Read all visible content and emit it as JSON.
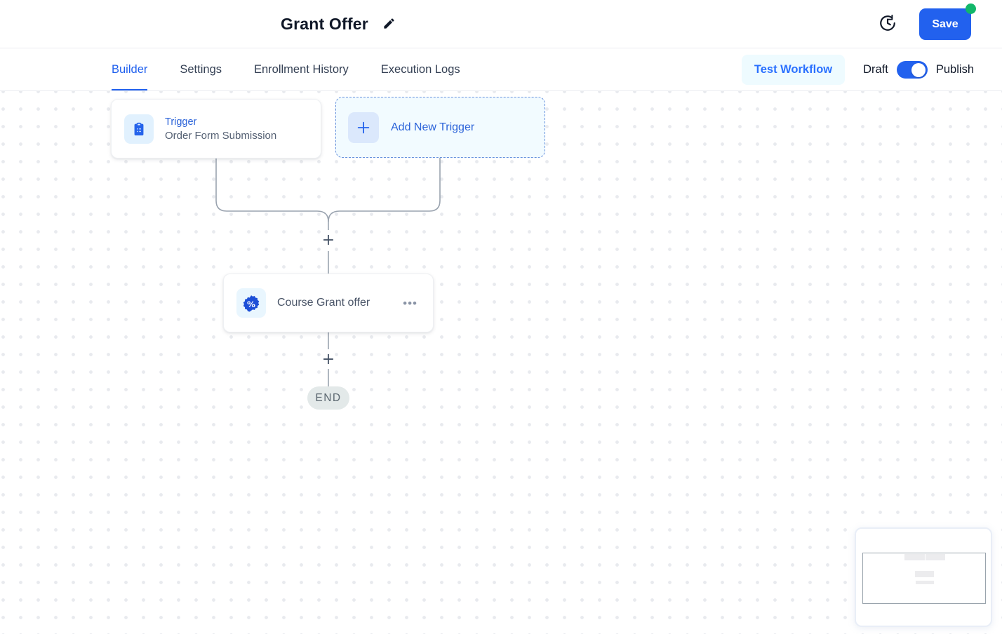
{
  "header": {
    "title": "Grant Offer",
    "save_label": "Save",
    "icons": {
      "edit": "pencil-icon",
      "history": "clock-history-icon"
    },
    "colors": {
      "accent": "#2261ee",
      "save_badge": "#12b76a"
    }
  },
  "tabs": {
    "items": [
      {
        "label": "Builder",
        "active": true
      },
      {
        "label": "Settings",
        "active": false
      },
      {
        "label": "Enrollment History",
        "active": false
      },
      {
        "label": "Execution Logs",
        "active": false
      }
    ],
    "test_workflow_label": "Test Workflow",
    "draft_label": "Draft",
    "publish_label": "Publish",
    "publish_toggle_on": true
  },
  "canvas": {
    "trigger_card": {
      "title": "Trigger",
      "subtitle": "Order Form Submission",
      "icon": "clipboard-icon"
    },
    "add_trigger_card": {
      "label": "Add New Trigger",
      "icon": "plus-icon"
    },
    "action_card": {
      "label": "Course Grant offer",
      "icon": "discount-badge-icon",
      "menu_glyph": "•••"
    },
    "plus_glyph": "+",
    "end_label": "END",
    "colors": {
      "connector": "#9aa3af",
      "card_blue_text": "#2b63d9",
      "end_pill_bg": "#e3e9e9"
    }
  },
  "minimap": {
    "present": true
  }
}
